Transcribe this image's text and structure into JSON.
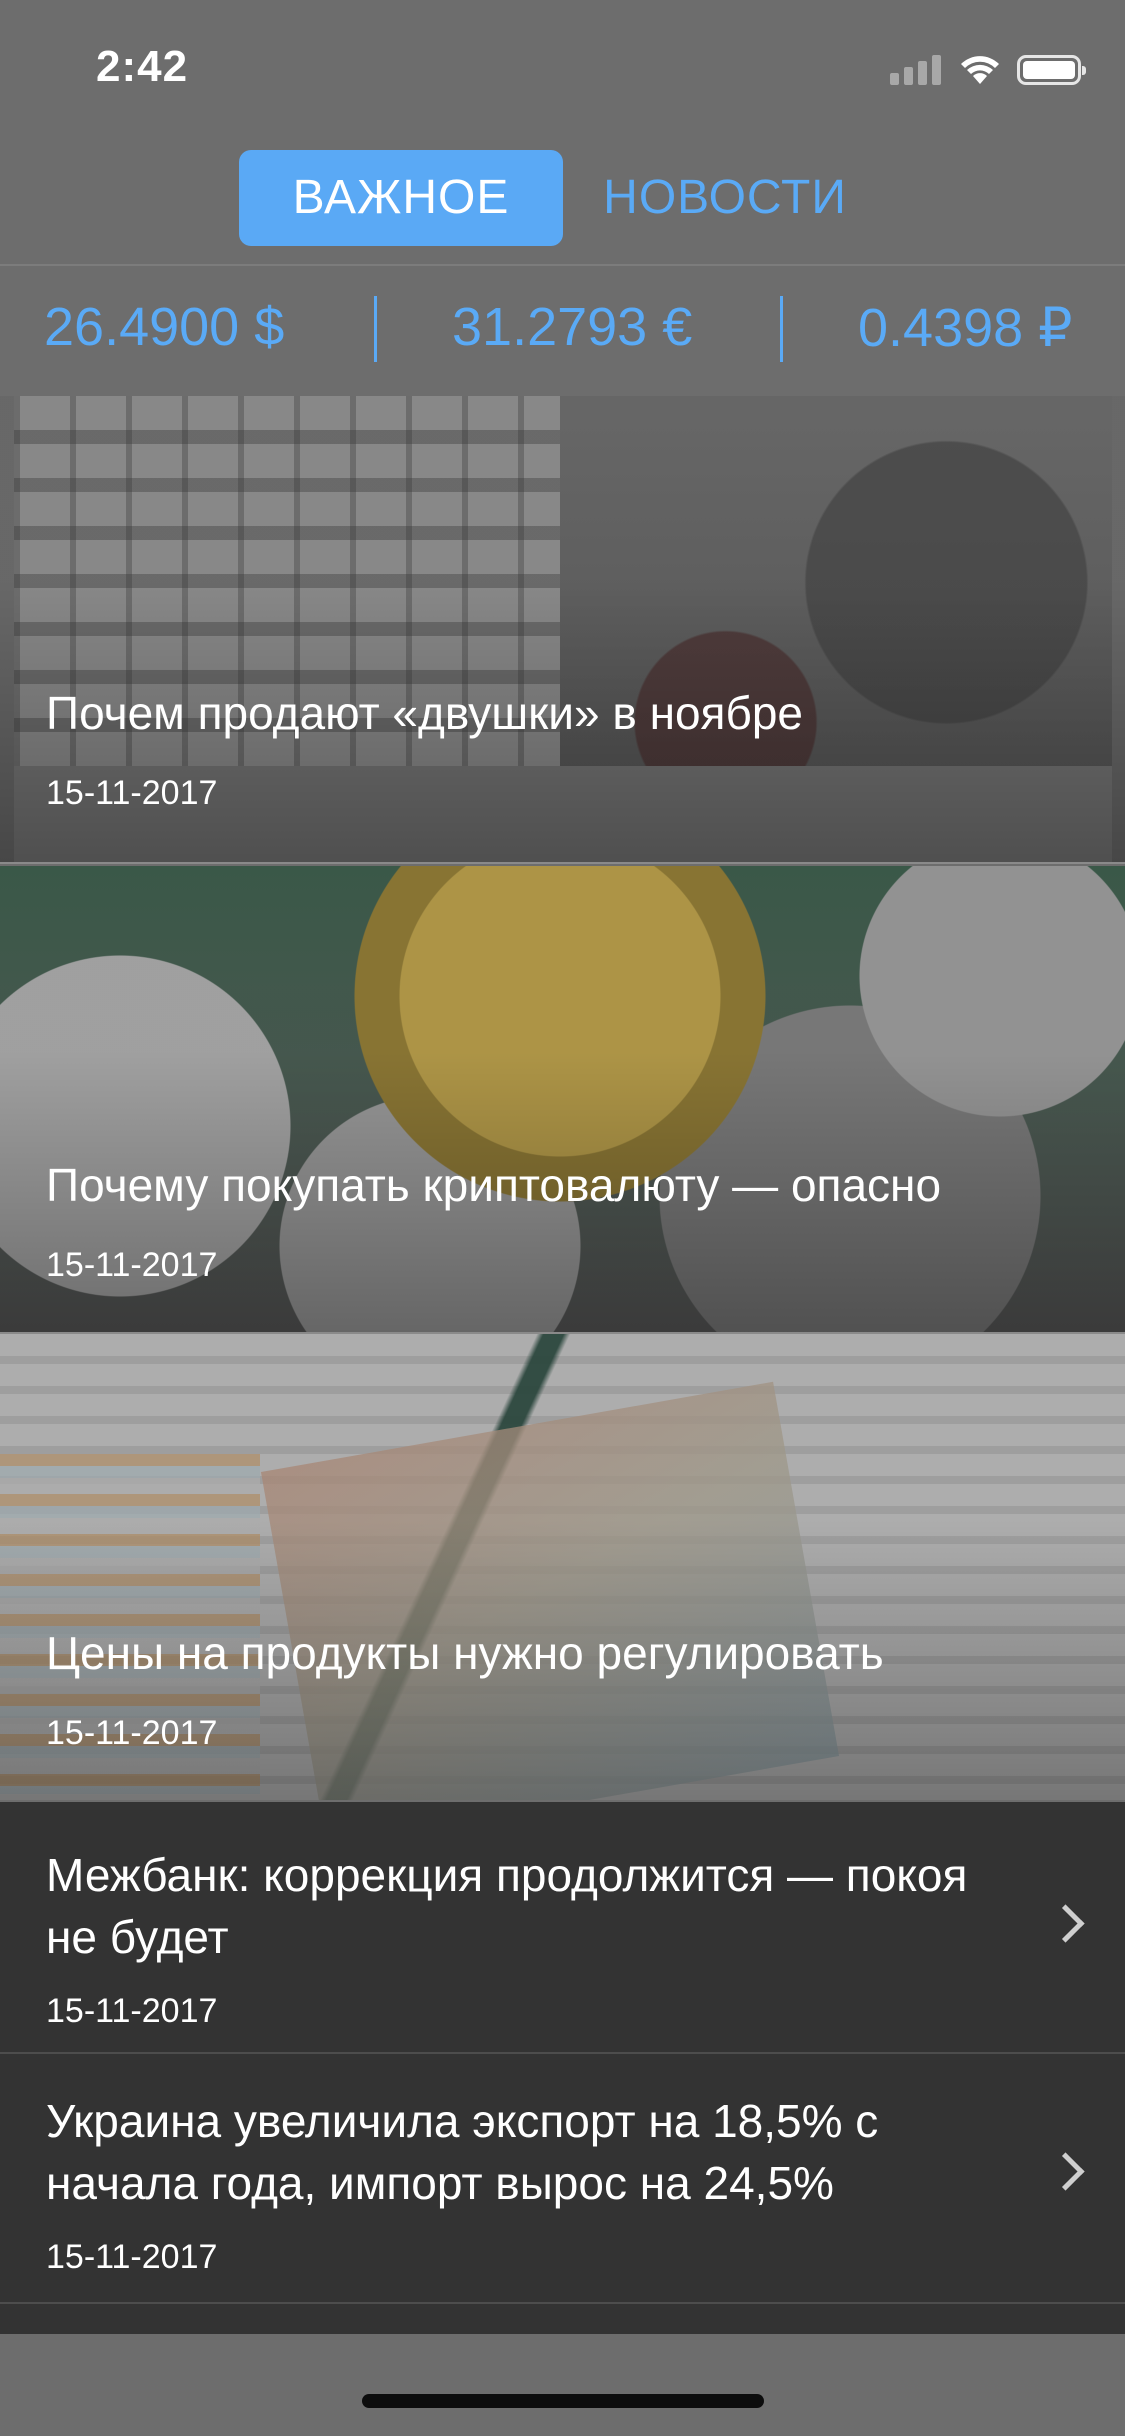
{
  "status_bar": {
    "time": "2:42",
    "signal_icon": "cellular-signal-icon",
    "wifi_icon": "wifi-icon",
    "battery_icon": "battery-icon"
  },
  "tabs": [
    {
      "label": "ВАЖНОЕ",
      "active": true
    },
    {
      "label": "НОВОСТИ",
      "active": false
    }
  ],
  "rates": {
    "usd": "26.4900 $",
    "eur": "31.2793 €",
    "rub": "0.4398 ₽",
    "accent_color": "#5aaaf6"
  },
  "featured": [
    {
      "title": "Почем продают «двушки» в ноябре",
      "date": "15-11-2017"
    },
    {
      "title": "Почему покупать криптовалюту — опасно",
      "date": "15-11-2017"
    },
    {
      "title": "Цены на продукты нужно регулировать",
      "date": "15-11-2017"
    }
  ],
  "list": [
    {
      "title": "Межбанк: коррекция продолжится — покоя не будет",
      "date": "15-11-2017",
      "icon": "chevron-right-icon"
    },
    {
      "title": "Украина увеличила экспорт на 18,5% с начала года, импорт вырос на 24,5%",
      "date": "15-11-2017",
      "icon": "chevron-right-icon"
    }
  ]
}
